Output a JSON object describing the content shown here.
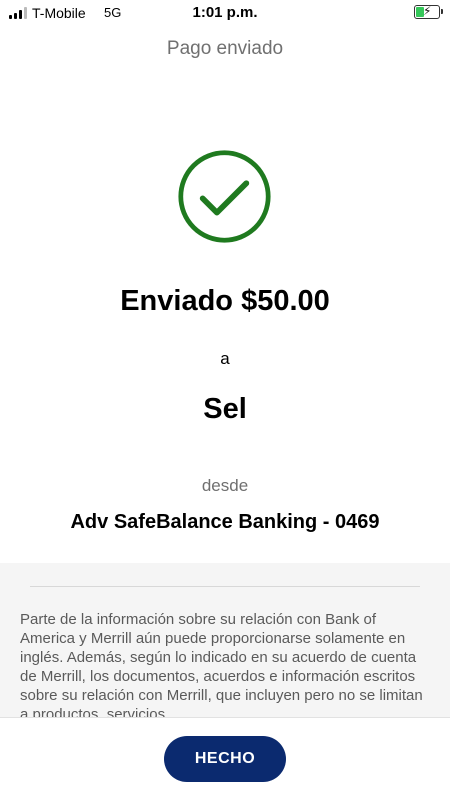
{
  "status_bar": {
    "carrier": "T-Mobile",
    "network": "5G",
    "time": "1:01 p.m.",
    "battery_color": "#35c759"
  },
  "header": {
    "title": "Pago enviado"
  },
  "confirmation": {
    "icon": "check-circle-icon",
    "icon_color": "#1f7a1f",
    "amount_text": "Enviado $50.00",
    "connector": "a",
    "recipient": "Sel",
    "from_label": "desde",
    "account": "Adv SafeBalance Banking - 0469"
  },
  "disclosure": {
    "text": "Parte de la información sobre su relación con Bank of America y Merrill aún puede proporcionarse solamente en inglés. Además, según lo indicado en su acuerdo de cuenta de Merrill, los documentos, acuerdos e información escritos sobre su relación con Merrill, que incluyen pero no se limitan a productos, servicios,"
  },
  "footer": {
    "done_label": "HECHO",
    "done_color": "#0b2a6f"
  }
}
